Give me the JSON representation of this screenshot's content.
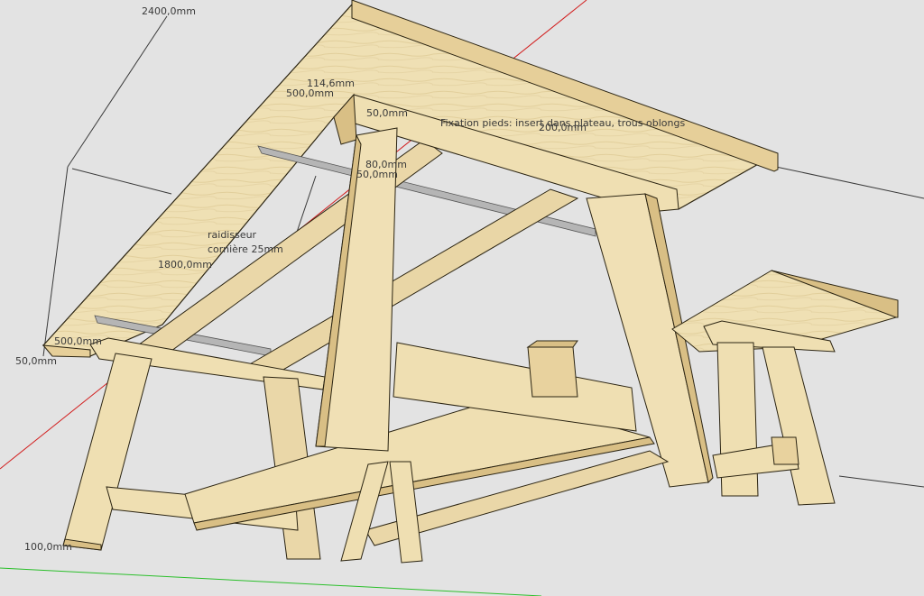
{
  "viewport": {
    "background": "#e3e3e3",
    "wood_light": "#efe0b4",
    "wood_mid": "#e6cf99",
    "wood_dark": "#cdb27a",
    "edge": "#2b2412",
    "axis_red": "#d21e1e",
    "axis_green": "#2bbf2b",
    "dimension_line": "#3a3a3a"
  },
  "dimensions": {
    "d2400": "2400,0mm",
    "d114": "114,6mm",
    "d500_top": "500,0mm",
    "d50_top": "50,0mm",
    "d200": "200,0mm",
    "d80": "80,0mm",
    "d50_mid": "50,0mm",
    "d1800": "1800,0mm",
    "d500_left": "500,0mm",
    "d50_left": "50,0mm",
    "d100": "100,0mm"
  },
  "annotations": {
    "fixation": "Fixation pieds: insert dans plateau, trous oblongs",
    "raidisseur_line1": "raidisseur",
    "raidisseur_line2": "cornière 25mm"
  }
}
